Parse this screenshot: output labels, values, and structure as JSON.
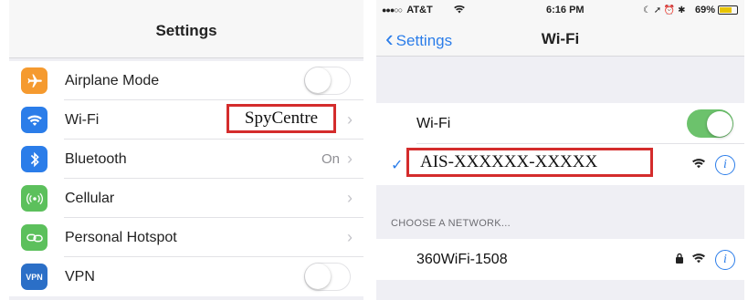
{
  "left": {
    "nav_title": "Settings",
    "items": [
      {
        "label": "Airplane Mode",
        "icon": "airplane-icon",
        "color": "#f59a2f",
        "control": "toggle-off"
      },
      {
        "label": "Wi-Fi",
        "icon": "wifi-icon",
        "color": "#2b7de9",
        "control": "chevron"
      },
      {
        "label": "Bluetooth",
        "icon": "bluetooth-icon",
        "color": "#2b7de9",
        "value": "On",
        "control": "chevron"
      },
      {
        "label": "Cellular",
        "icon": "cellular-icon",
        "color": "#5cc05c",
        "control": "chevron"
      },
      {
        "label": "Personal Hotspot",
        "icon": "hotspot-icon",
        "color": "#5cc05c",
        "control": "chevron"
      },
      {
        "label": "VPN",
        "icon": "vpn-icon",
        "icon_text": "VPN",
        "color": "#2b6fc7",
        "control": "toggle-off"
      }
    ],
    "wifi_overlay": "SpyCentre"
  },
  "right": {
    "status": {
      "carrier": "AT&T",
      "time": "6:16 PM",
      "battery": "69%"
    },
    "back_label": "Settings",
    "nav_title": "Wi-Fi",
    "wifi_label": "Wi-Fi",
    "wifi_on": true,
    "connected_network": "AIS-XXXXXX-XXXXX",
    "section_header": "CHOOSE A NETWORK...",
    "networks": [
      {
        "name": "360WiFi-1508",
        "locked": true
      }
    ],
    "info_glyph": "i"
  },
  "colors": {
    "accent": "#2b7de9",
    "toggle_on": "#6cc26c",
    "highlight_box": "#d42c2c"
  }
}
